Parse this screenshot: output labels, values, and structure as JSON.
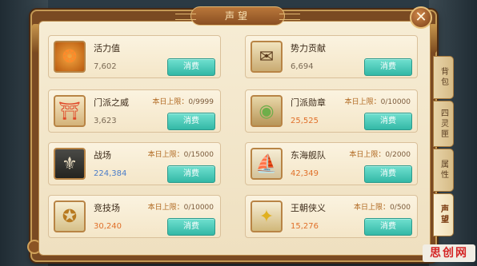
{
  "window": {
    "title": "声望",
    "close_label": "✕"
  },
  "side_tabs": [
    {
      "label": "背包",
      "active": false
    },
    {
      "label": "四灵匣",
      "active": false
    },
    {
      "label": "属性",
      "active": false
    },
    {
      "label": "声望",
      "active": true
    }
  ],
  "colors": {
    "button": "#33b8a6",
    "value_orange": "#e0702a",
    "value_blue": "#4a7cc8",
    "panel": "#f4e6c8"
  },
  "cards": [
    {
      "name": "活力值",
      "value": "7,602",
      "limit_label": "",
      "limit_value": "",
      "button": "消费",
      "icon": "vitality-icon"
    },
    {
      "name": "势力贡献",
      "value": "6,694",
      "limit_label": "",
      "limit_value": "",
      "button": "消费",
      "icon": "contribution-token-icon"
    },
    {
      "name": "门派之威",
      "value": "3,623",
      "limit_label": "本日上限：",
      "limit_value": "0/9999",
      "button": "消费",
      "icon": "sect-gate-icon"
    },
    {
      "name": "门派勋章",
      "value": "25,525",
      "limit_label": "本日上限：",
      "limit_value": "0/10000",
      "button": "消费",
      "icon": "sect-medal-icon"
    },
    {
      "name": "战场",
      "value": "224,384",
      "limit_label": "本日上限：",
      "limit_value": "0/15000",
      "button": "消费",
      "icon": "battlefield-icon"
    },
    {
      "name": "东海舰队",
      "value": "42,349",
      "limit_label": "本日上限：",
      "limit_value": "0/2000",
      "button": "消费",
      "icon": "warship-icon"
    },
    {
      "name": "竞技场",
      "value": "30,240",
      "limit_label": "本日上限：",
      "limit_value": "0/10000",
      "button": "消费",
      "icon": "arena-coin-icon"
    },
    {
      "name": "王朝侠义",
      "value": "15,276",
      "limit_label": "本日上限：",
      "limit_value": "0/500",
      "button": "消费",
      "icon": "dynasty-token-icon"
    }
  ],
  "watermark": "思创网"
}
